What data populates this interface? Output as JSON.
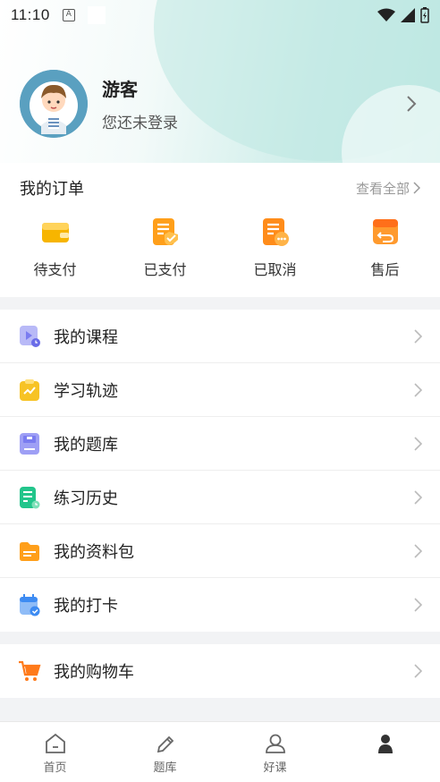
{
  "status_bar": {
    "time": "11:10",
    "notification_icon": "A"
  },
  "profile": {
    "name": "游客",
    "subtitle": "您还未登录",
    "avatar_icon": "cartoon-avatar"
  },
  "orders": {
    "title": "我的订单",
    "view_all": "查看全部",
    "items": [
      {
        "label": "待支付",
        "icon": "wallet-icon",
        "color": "#f7b500"
      },
      {
        "label": "已支付",
        "icon": "paid-doc-icon",
        "color": "#ff9f1a"
      },
      {
        "label": "已取消",
        "icon": "cancel-doc-icon",
        "color": "#ff8c1a"
      },
      {
        "label": "售后",
        "icon": "return-box-icon",
        "color": "#ff7a1a"
      }
    ]
  },
  "menu": [
    {
      "label": "我的课程",
      "icon": "course-play-icon",
      "color": "#7a7cf0"
    },
    {
      "label": "学习轨迹",
      "icon": "trend-clipboard-icon",
      "color": "#f7c325"
    },
    {
      "label": "我的题库",
      "icon": "question-bank-icon",
      "color": "#7a7cf0"
    },
    {
      "label": "练习历史",
      "icon": "practice-history-icon",
      "color": "#22c58b"
    },
    {
      "label": "我的资料包",
      "icon": "folder-icon",
      "color": "#ff9f1a"
    },
    {
      "label": "我的打卡",
      "icon": "calendar-check-icon",
      "color": "#3d8bf2"
    }
  ],
  "menu2": [
    {
      "label": "我的购物车",
      "icon": "cart-icon",
      "color": "#ff7a1a"
    }
  ],
  "tabbar": [
    {
      "label": "首页",
      "icon": "home-icon"
    },
    {
      "label": "题库",
      "icon": "pencil-icon"
    },
    {
      "label": "好课",
      "icon": "user-icon"
    },
    {
      "label": "",
      "icon": "person-icon"
    }
  ]
}
